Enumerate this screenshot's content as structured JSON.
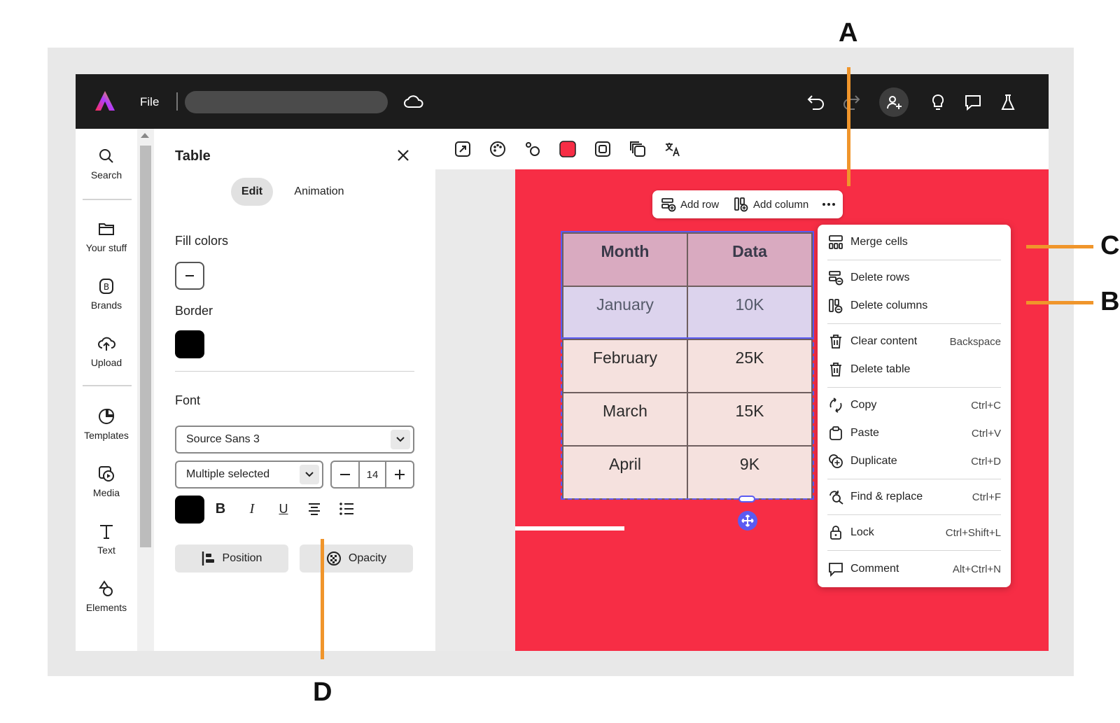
{
  "header": {
    "file_label": "File"
  },
  "rail": {
    "items": [
      {
        "label": "Search",
        "icon": "search-icon"
      },
      {
        "label": "Your stuff",
        "icon": "folder-icon"
      },
      {
        "label": "Brands",
        "icon": "brands-icon"
      },
      {
        "label": "Upload",
        "icon": "upload-icon"
      },
      {
        "label": "Templates",
        "icon": "templates-icon"
      },
      {
        "label": "Media",
        "icon": "media-icon"
      },
      {
        "label": "Text",
        "icon": "text-icon"
      },
      {
        "label": "Elements",
        "icon": "elements-icon"
      }
    ]
  },
  "panel": {
    "title": "Table",
    "tabs": {
      "edit": "Edit",
      "animation": "Animation"
    },
    "fill_colors_label": "Fill colors",
    "border_label": "Border",
    "border_color": "#000000",
    "font_label": "Font",
    "font_family": "Source Sans 3",
    "font_weight": "Multiple selected",
    "font_size": "14",
    "text_color": "#000000",
    "format": {
      "bold": "B",
      "italic": "I",
      "underline": "U"
    },
    "position_label": "Position",
    "opacity_label": "Opacity"
  },
  "canvas": {
    "background_color": "#f72d45",
    "table_toolbar": {
      "add_row": "Add row",
      "add_column": "Add column"
    },
    "table": {
      "header": [
        "Month",
        "Data"
      ],
      "rows": [
        [
          "January",
          "10K"
        ],
        [
          "February",
          "25K"
        ],
        [
          "March",
          "15K"
        ],
        [
          "April",
          "9K"
        ]
      ]
    }
  },
  "context_menu": {
    "items": [
      {
        "label": "Merge cells",
        "shortcut": ""
      },
      {
        "label": "Delete rows",
        "shortcut": ""
      },
      {
        "label": "Delete columns",
        "shortcut": ""
      },
      {
        "label": "Clear content",
        "shortcut": "Backspace"
      },
      {
        "label": "Delete table",
        "shortcut": ""
      },
      {
        "label": "Copy",
        "shortcut": "Ctrl+C"
      },
      {
        "label": "Paste",
        "shortcut": "Ctrl+V"
      },
      {
        "label": "Duplicate",
        "shortcut": "Ctrl+D"
      },
      {
        "label": "Find & replace",
        "shortcut": "Ctrl+F"
      },
      {
        "label": "Lock",
        "shortcut": "Ctrl+Shift+L"
      },
      {
        "label": "Comment",
        "shortcut": "Alt+Ctrl+N"
      }
    ]
  },
  "annotations": {
    "a": "A",
    "b": "B",
    "c": "C",
    "d": "D"
  }
}
